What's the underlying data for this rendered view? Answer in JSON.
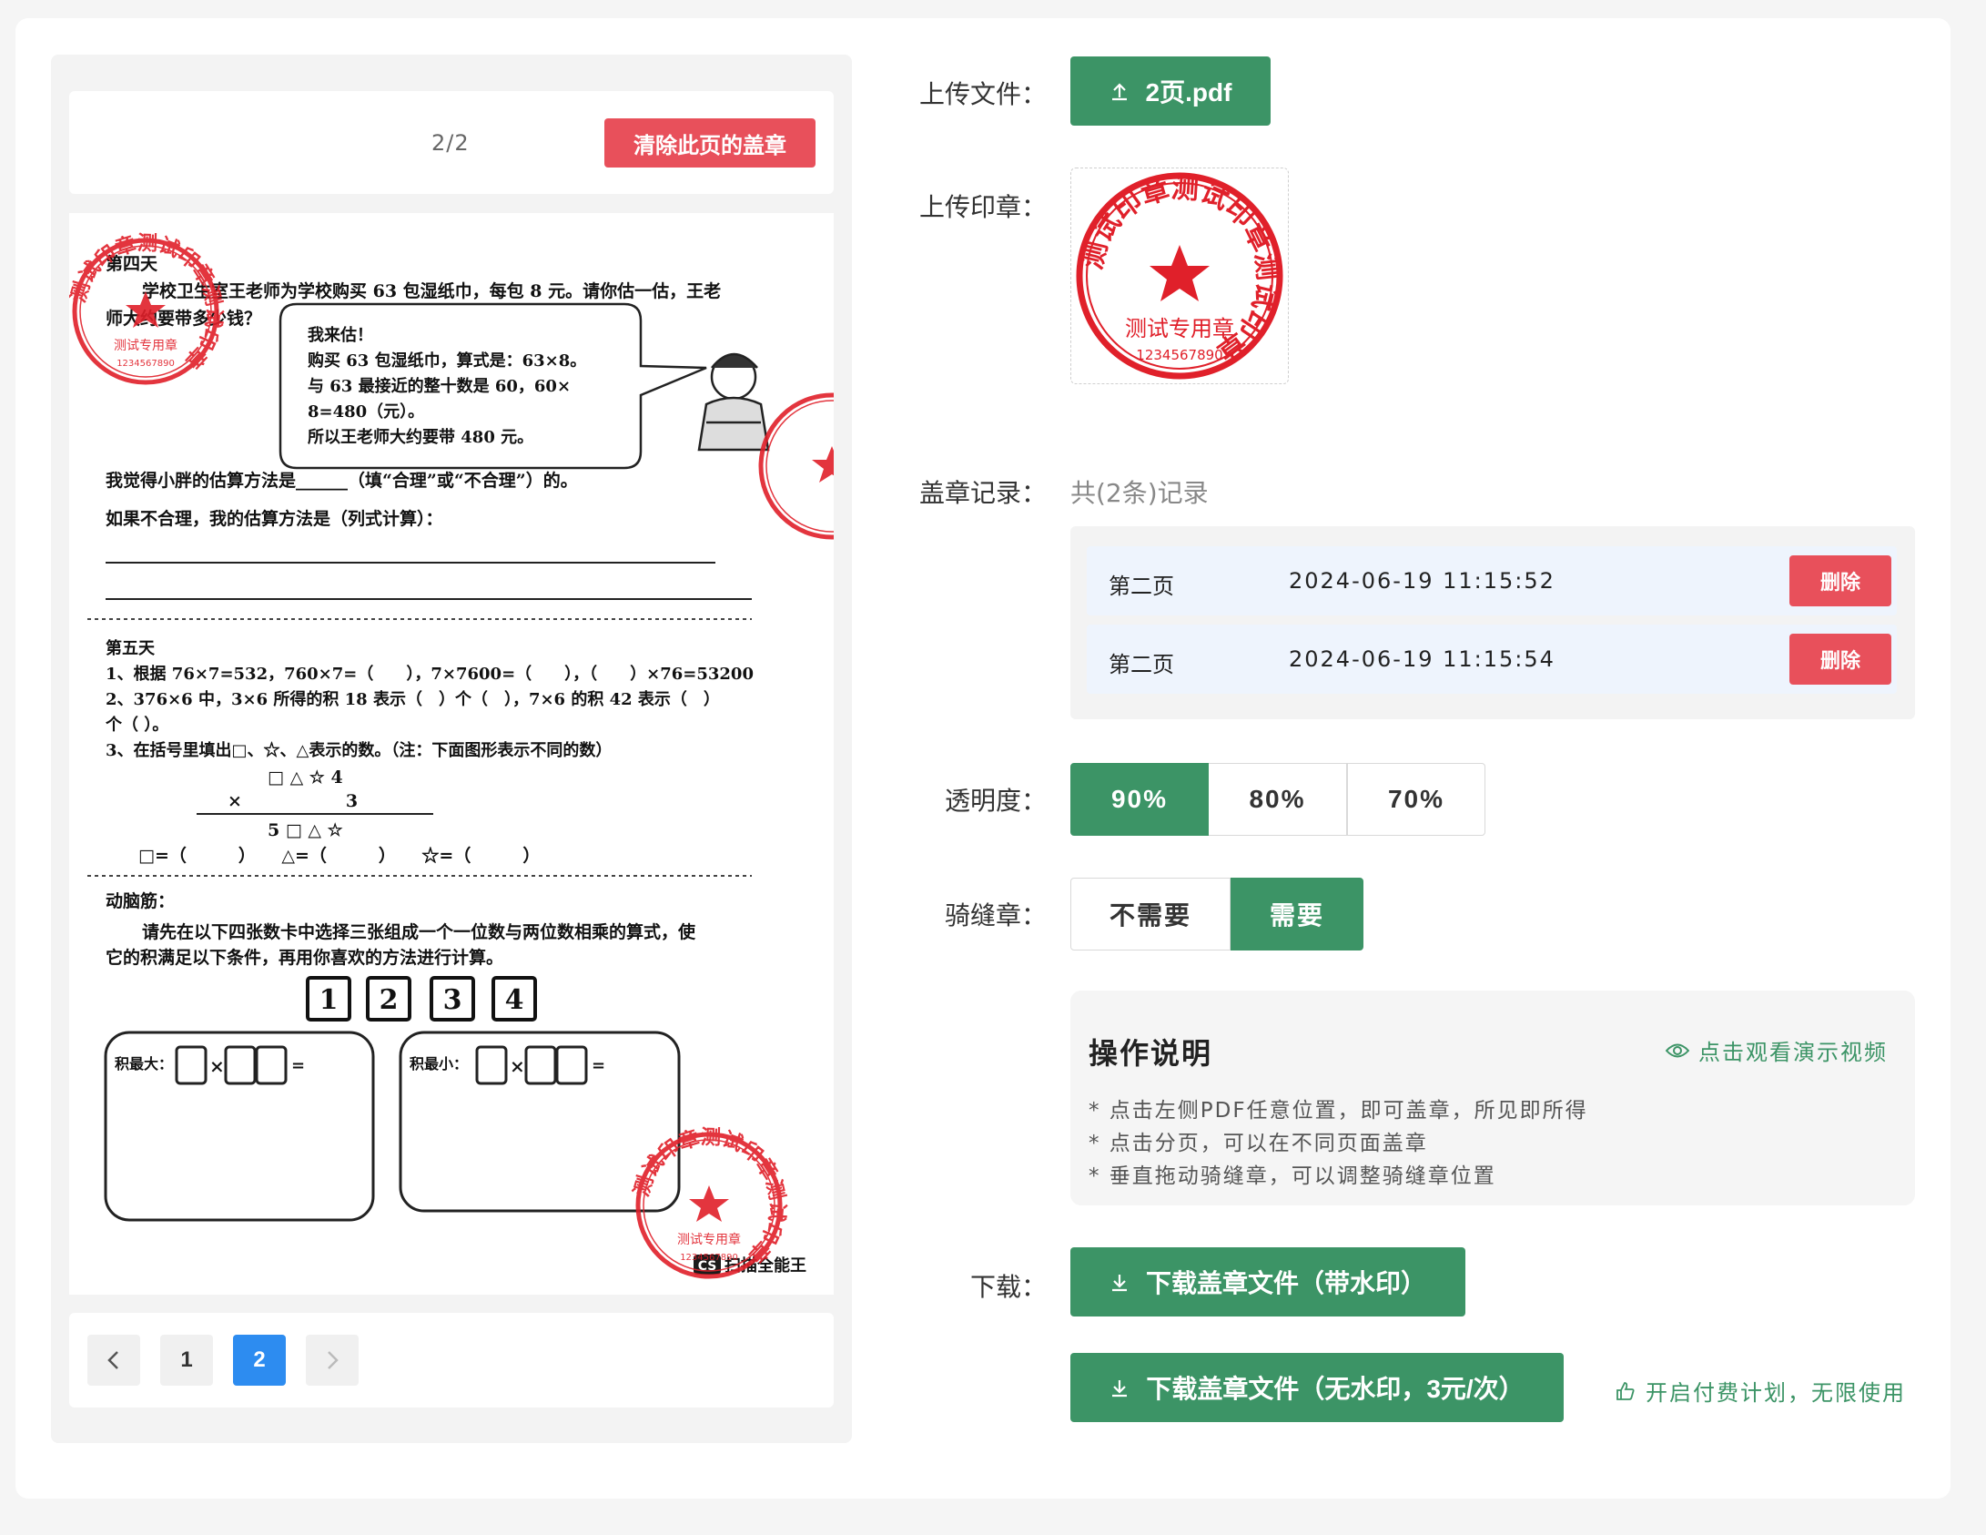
{
  "preview": {
    "page_indicator": "2/2",
    "clear_button": "清除此页的盖章",
    "pagination": {
      "prev_icon": "chevron-left-icon",
      "next_icon": "chevron-right-icon",
      "pages": [
        "1",
        "2"
      ],
      "current": "2"
    },
    "document": {
      "day4_title": "第四天",
      "day4_q1": "学校卫生室王老师为学校购买 63 包湿纸巾，每包 8 元。请你估一估，王老",
      "day4_q1b": "师大约要带多少钱？",
      "bubble": [
        "我来估！",
        "购买 63 包湿纸巾，算式是：63×8。",
        "与 63 最接近的整十数是 60，60×",
        "8=480（元）。",
        "所以王老师大约要带 480 元。"
      ],
      "day4_q2": "我觉得小胖的估算方法是______（填“合理”或“不合理”）的。",
      "day4_q3": "如果不合理，我的估算方法是（列式计算）：",
      "day5_title": "第五天",
      "day5_q1": "1、根据 76×7=532，760×7=（　　），7×7600=（　　），（　　）×76=53200",
      "day5_q2": "2、376×6 中，3×6 所得的积 18 表示（　）个（　），7×6 的积 42 表示（　）",
      "day5_q2b": "个（ ）。",
      "day5_q3": "3、在括号里填出□、☆、△表示的数。（注：下面图形表示不同的数）",
      "calc_row1": "□ △ ☆ 4",
      "calc_row2": "×　　　　　　3",
      "calc_row3": "5 □ △ ☆",
      "calc_answers": "□=（　　　）　　△=（　　　）　　☆=（　　　）",
      "brain_title": "动脑筋：",
      "brain_q": "请先在以下四张数卡中选择三张组成一个一位数与两位数相乘的算式，使",
      "brain_qb": "它的积满足以下条件，再用你喜欢的方法进行计算。",
      "cards": [
        "1",
        "2",
        "3",
        "4"
      ],
      "box_max": "积最大：",
      "box_min": "积最小：",
      "scanner_logo": "CS",
      "scanner_name": "扫描全能王"
    },
    "stamp_text": {
      "ring": "测试印章测试印章测试印章",
      "center": "测试专用章",
      "code": "1234567890"
    }
  },
  "form": {
    "upload_file": {
      "label": "上传文件：",
      "file_name": "2页.pdf",
      "icon": "upload-icon"
    },
    "upload_stamp": {
      "label": "上传印章："
    },
    "records": {
      "label": "盖章记录：",
      "summary": "共(2条)记录",
      "items": [
        {
          "page": "第二页",
          "time": "2024-06-19 11:15:52",
          "delete": "删除"
        },
        {
          "page": "第二页",
          "time": "2024-06-19 11:15:54",
          "delete": "删除"
        }
      ]
    },
    "opacity": {
      "label": "透明度：",
      "options": [
        "90%",
        "80%",
        "70%"
      ],
      "selected": "90%"
    },
    "seam": {
      "label": "骑缝章：",
      "options": [
        "不需要",
        "需要"
      ],
      "selected": "需要"
    },
    "help": {
      "title": "操作说明",
      "video_link": "点击观看演示视频",
      "video_icon": "eye-icon",
      "lines": [
        "* 点击左侧PDF任意位置，即可盖章，所见即所得",
        "* 点击分页，可以在不同页面盖章",
        "* 垂直拖动骑缝章，可以调整骑缝章位置"
      ]
    },
    "download": {
      "label": "下载：",
      "watermark_button": "下载盖章文件（带水印）",
      "clean_button": "下载盖章文件（无水印，3元/次）",
      "icon": "download-icon",
      "paid_link": "开启付费计划，无限使用",
      "paid_icon": "thumbs-up-icon"
    }
  },
  "colors": {
    "primary_green": "#3c9466",
    "danger_red": "#e8505b",
    "stamp_red": "#e0202a",
    "pager_blue": "#2d8cf0"
  }
}
